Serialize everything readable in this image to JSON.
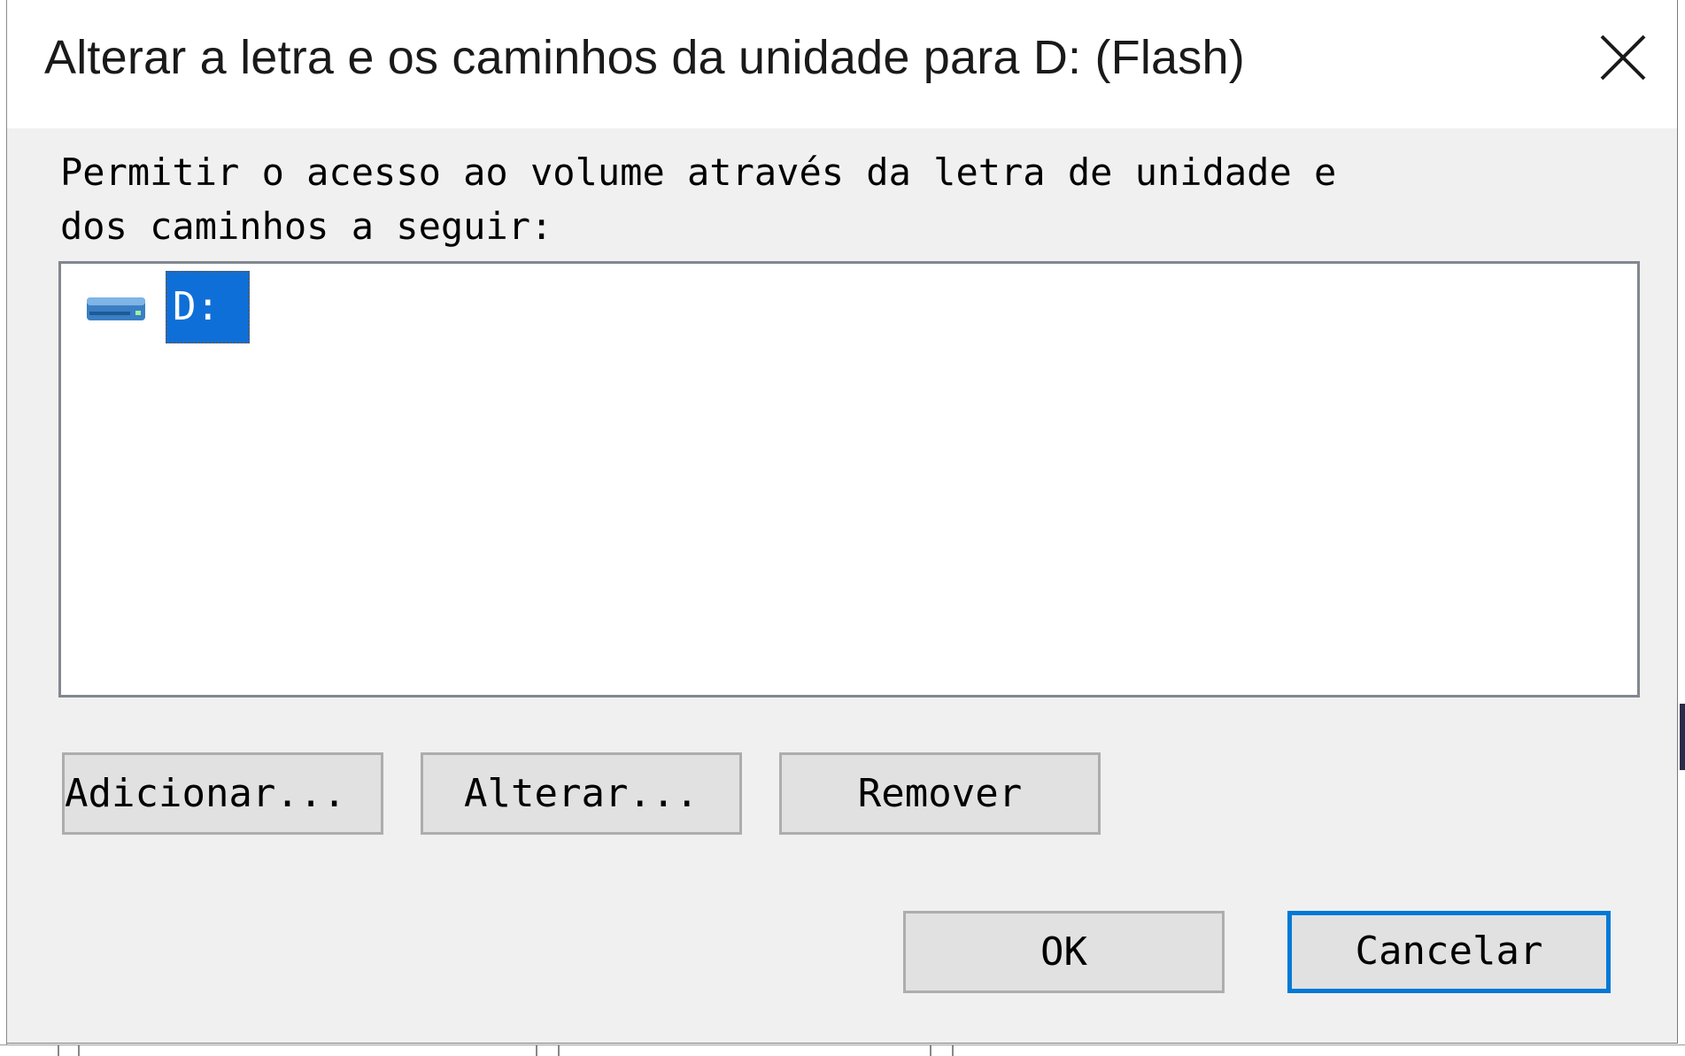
{
  "dialog": {
    "title": "Alterar a letra e os caminhos da unidade para D: (Flash)",
    "close_icon": "close-icon",
    "description": "Permitir o acesso ao volume através da letra de unidade e\ndos caminhos a seguir:"
  },
  "paths_list": {
    "items": [
      {
        "icon": "drive-icon",
        "label": "D:",
        "selected": true
      }
    ]
  },
  "buttons": {
    "add": "Adicionar...",
    "change": "Alterar...",
    "remove": "Remover",
    "ok": "OK",
    "cancel": "Cancelar"
  },
  "colors": {
    "selection": "#0f6fd8",
    "focus_border": "#0078d7",
    "dialog_bg": "#f0f0f0"
  }
}
